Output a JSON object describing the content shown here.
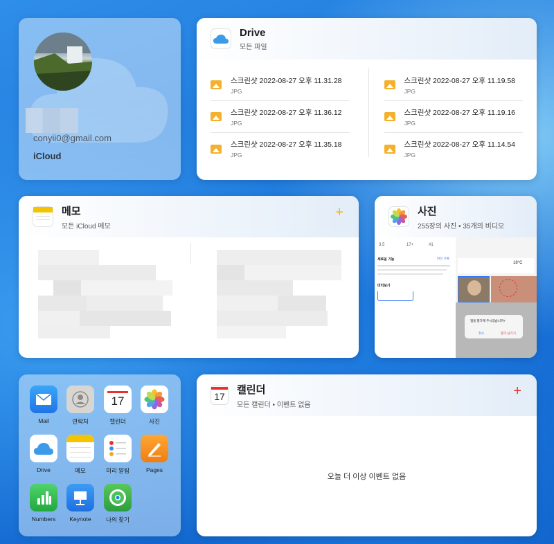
{
  "profile": {
    "email": "conyii0@gmail.com",
    "service": "iCloud"
  },
  "drive": {
    "title": "Drive",
    "subtitle": "모든 파일",
    "files_left": [
      {
        "name": "스크린샷 2022-08-27 오후 11.31.28",
        "type": "JPG"
      },
      {
        "name": "스크린샷 2022-08-27 오후 11.36.12",
        "type": "JPG"
      },
      {
        "name": "스크린샷 2022-08-27 오후 11.35.18",
        "type": "JPG"
      }
    ],
    "files_right": [
      {
        "name": "스크린샷 2022-08-27 오후 11.19.58",
        "type": "JPG"
      },
      {
        "name": "스크린샷 2022-08-27 오후 11.19.16",
        "type": "JPG"
      },
      {
        "name": "스크린샷 2022-08-27 오후 11.14.54",
        "type": "JPG"
      }
    ]
  },
  "notes": {
    "title": "메모",
    "subtitle": "모든 iCloud 메모",
    "add_label": "+"
  },
  "photos": {
    "title": "사진",
    "subtitle": "255장의 사진 • 35개의 비디오",
    "thumb": {
      "stat1": "3.5",
      "stat2": "17+",
      "stat3": "#1",
      "section_title": "새로운 기능",
      "section_link": "버전 기록",
      "preview_title": "미리보기",
      "weather": "18°C",
      "dialog_text": "앱을 평가해 주시겠습니까?",
      "dialog_cancel": "취소",
      "dialog_ok": "평가 남기기"
    }
  },
  "apps": [
    {
      "label": "Mail",
      "icon": "mail-icon"
    },
    {
      "label": "연락처",
      "icon": "contacts-icon"
    },
    {
      "label": "캘린더",
      "icon": "calendar-icon",
      "day": "17"
    },
    {
      "label": "사진",
      "icon": "photos-icon"
    },
    {
      "label": "Drive",
      "icon": "drive-icon"
    },
    {
      "label": "메모",
      "icon": "notes-icon"
    },
    {
      "label": "미리 알림",
      "icon": "reminders-icon"
    },
    {
      "label": "Pages",
      "icon": "pages-icon"
    },
    {
      "label": "Numbers",
      "icon": "numbers-icon"
    },
    {
      "label": "Keynote",
      "icon": "keynote-icon"
    },
    {
      "label": "나의 찾기",
      "icon": "find-my-icon"
    }
  ],
  "calendar": {
    "day": "17",
    "title": "캘린더",
    "subtitle": "모든 캘린더 • 이벤트 없음",
    "add_label": "+",
    "empty_text": "오늘 더 이상 이벤트 없음"
  },
  "colors": {
    "accent_blue": "#1a73d9",
    "file_icon": "#f3b12d",
    "calendar_red": "#e8322e",
    "notes_yellow": "#f5c400"
  }
}
